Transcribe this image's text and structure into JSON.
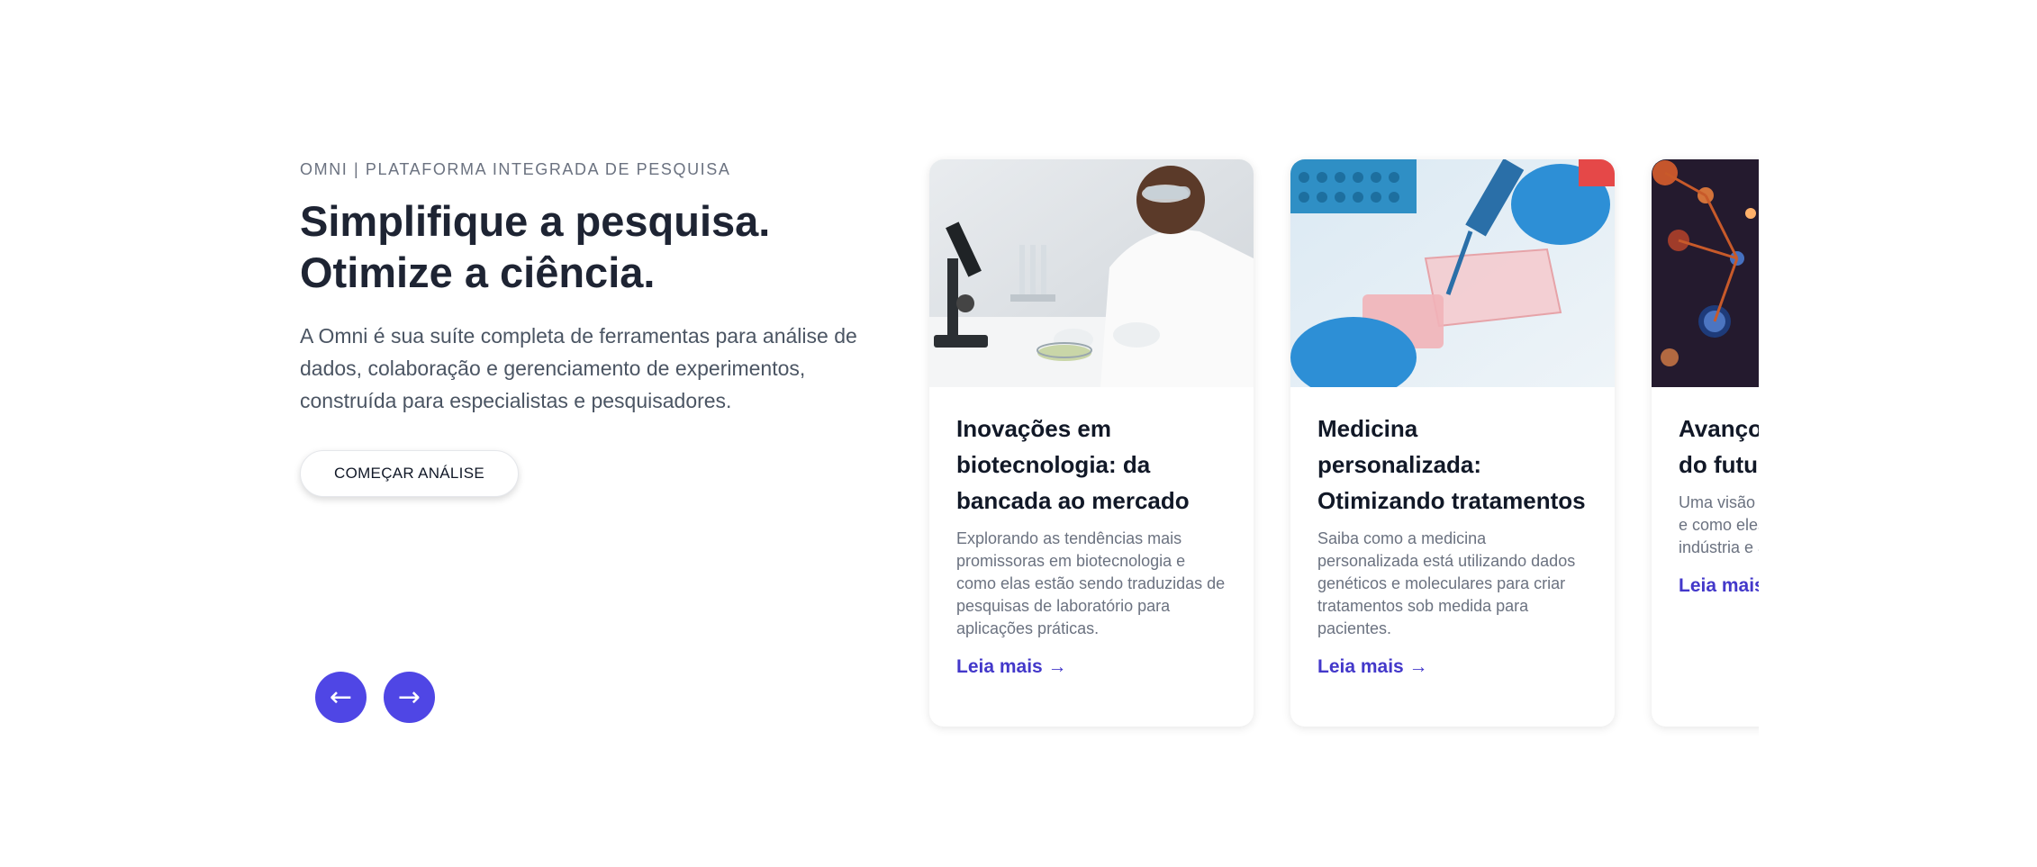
{
  "hero": {
    "eyebrow": "OMNI | PLATAFORMA INTEGRADA DE PESQUISA",
    "headline_line1": "Simplifique a pesquisa.",
    "headline_line2": "Otimize a ciência.",
    "description": "A Omni é sua suíte completa de ferramentas para análise de dados, colaboração e gerenciamento de experimentos, construída para especialistas e pesquisadores.",
    "cta_label": "COMEÇAR ANÁLISE"
  },
  "carousel": {
    "prev_label": "←",
    "next_label": "→",
    "cards": [
      {
        "title": "Inovações em biotecnologia: da bancada ao mercado",
        "text": "Explorando as tendências mais promissoras em biotecnologia e como elas estão sendo traduzidas de pesquisas de laboratório para aplicações práticas.",
        "link": "Leia mais →",
        "image": "scientist-microscope-photo"
      },
      {
        "title": "Medicina personalizada: Otimizando tratamentos",
        "text": "Saiba como a medicina personalizada está utilizando dados genéticos e moleculares para criar tratamentos sob medida para pacientes.",
        "link": "Leia mais →",
        "image": "pipette-lab-photo"
      },
      {
        "title": "Avanços em materiais do futuro",
        "text": "Uma visão dos avanços em materiais e como eles estão moldando a indústria e a tecnologia.",
        "link": "Leia mais →",
        "image": "molecular-structure-photo"
      }
    ]
  },
  "colors": {
    "accent": "#4f46e5",
    "heading": "#1e2433",
    "body_text": "#4b5563",
    "muted": "#6b7280"
  }
}
